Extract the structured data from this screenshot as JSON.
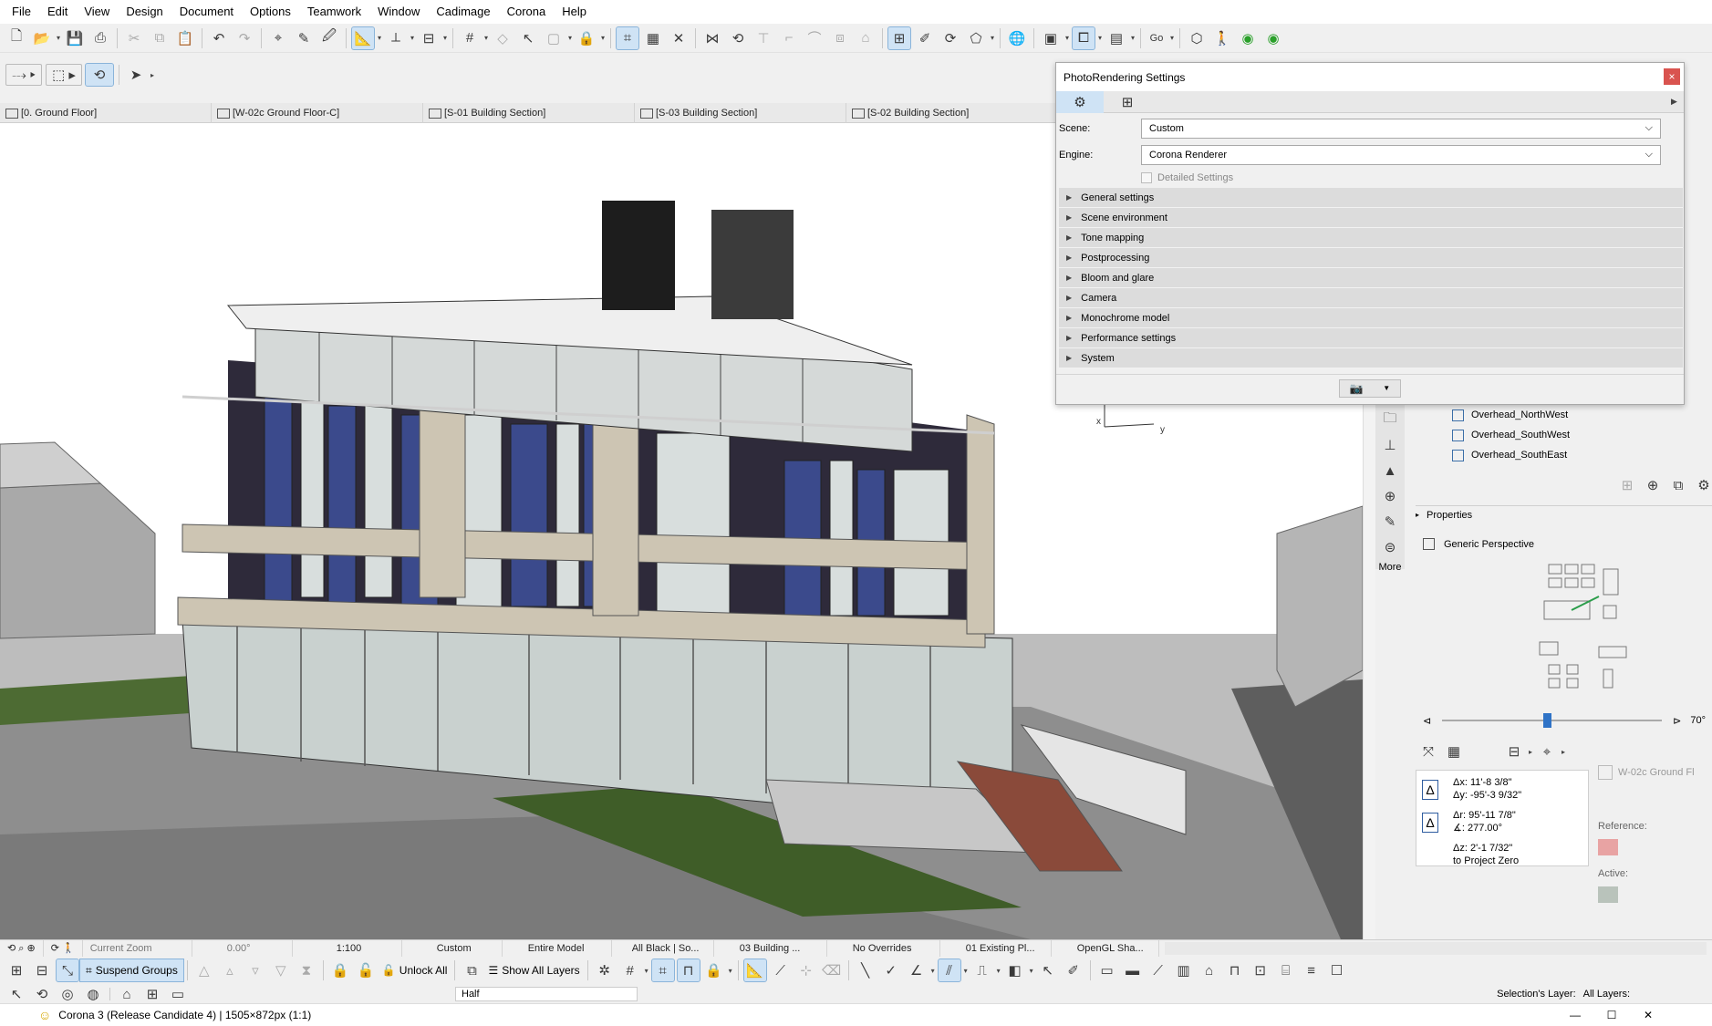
{
  "menu": [
    "File",
    "Edit",
    "View",
    "Design",
    "Document",
    "Options",
    "Teamwork",
    "Window",
    "Cadimage",
    "Corona",
    "Help"
  ],
  "toolbar": {
    "go_label": "Go"
  },
  "tabs": [
    {
      "label": "[0. Ground Floor]"
    },
    {
      "label": "[W-02c Ground Floor-C]"
    },
    {
      "label": "[S-01 Building Section]"
    },
    {
      "label": "[S-03 Building Section]"
    },
    {
      "label": "[S-02 Building Section]"
    }
  ],
  "dialog": {
    "title": "PhotoRendering Settings",
    "close": "×",
    "scene_label": "Scene:",
    "scene_value": "Custom",
    "engine_label": "Engine:",
    "engine_value": "Corona Renderer",
    "detailed_label": "Detailed Settings",
    "sections": [
      "General settings",
      "Scene environment",
      "Tone mapping",
      "Postprocessing",
      "Bloom and glare",
      "Camera",
      "Monochrome model",
      "Performance settings",
      "System"
    ]
  },
  "viewpoints": [
    "Overhead_NorthWest",
    "Overhead_SouthWest",
    "Overhead_SouthEast"
  ],
  "panel": {
    "properties": "Properties",
    "perspective": "Generic Perspective",
    "more": "More",
    "angle": "70°",
    "view_name": "W-02c Ground Fl",
    "reference": "Reference:",
    "active": "Active:"
  },
  "coords": {
    "dx1": "Δx: 11'-8 3/8\"",
    "dy1": "Δy: -95'-3 9/32\"",
    "dr": "Δr: 95'-11 7/8\"",
    "da": "∡: 277.00°",
    "dz": "Δz: 2'-1 7/32\"",
    "zero": "to Project Zero"
  },
  "status": {
    "zoom": "Current Zoom",
    "angle": "0.00°",
    "scale": "1:100",
    "custom": "Custom",
    "model": "Entire Model",
    "pen": "All Black | So...",
    "building": "03 Building ...",
    "overrides": "No Overrides",
    "existing": "01 Existing Pl...",
    "opengl": "OpenGL Sha..."
  },
  "bottom": {
    "suspend": "Suspend Groups",
    "unlock": "Unlock All",
    "showlayers": "Show All Layers",
    "half": "Half",
    "sel_layer": "Selection's Layer:",
    "all_layers": "All Layers:"
  },
  "taskbar": {
    "title": "Corona 3 (Release Candidate 4) | 1505×872px (1:1)"
  }
}
